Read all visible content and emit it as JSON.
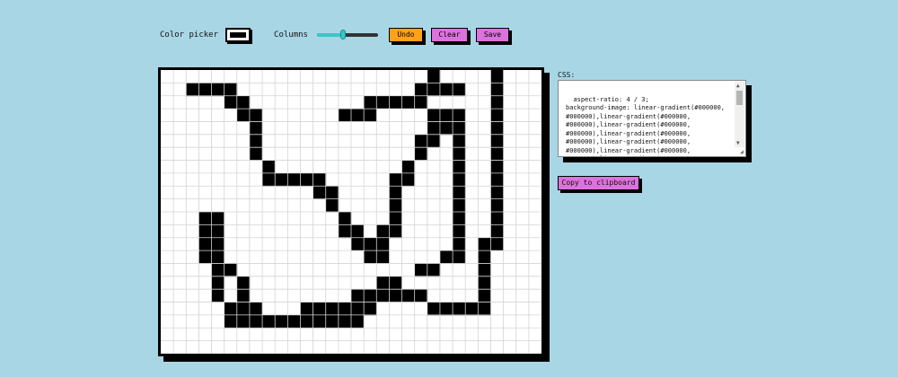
{
  "toolbar": {
    "color_picker_label": "Color picker",
    "color_value": "#000000",
    "columns_label": "Columns",
    "columns_slider_level": 0.42,
    "undo_label": "Undo",
    "clear_label": "Clear",
    "save_label": "Save"
  },
  "colors": {
    "background": "#a9d6e5",
    "undo_button": "#ffa21a",
    "secondary_button": "#dc72dc",
    "slider_accent": "#37c8c8",
    "pixel_fill": "#000000",
    "grid_line": "#d4d4d4"
  },
  "canvas": {
    "columns": 30,
    "rows": 22,
    "filled_cells": [
      [
        21,
        0
      ],
      [
        26,
        0
      ],
      [
        2,
        1
      ],
      [
        3,
        1
      ],
      [
        4,
        1
      ],
      [
        5,
        1
      ],
      [
        20,
        1
      ],
      [
        21,
        1
      ],
      [
        22,
        1
      ],
      [
        23,
        1
      ],
      [
        26,
        1
      ],
      [
        5,
        2
      ],
      [
        6,
        2
      ],
      [
        16,
        2
      ],
      [
        17,
        2
      ],
      [
        18,
        2
      ],
      [
        19,
        2
      ],
      [
        20,
        2
      ],
      [
        26,
        2
      ],
      [
        6,
        3
      ],
      [
        7,
        3
      ],
      [
        14,
        3
      ],
      [
        15,
        3
      ],
      [
        16,
        3
      ],
      [
        21,
        3
      ],
      [
        22,
        3
      ],
      [
        23,
        3
      ],
      [
        26,
        3
      ],
      [
        7,
        4
      ],
      [
        21,
        4
      ],
      [
        22,
        4
      ],
      [
        23,
        4
      ],
      [
        26,
        4
      ],
      [
        7,
        5
      ],
      [
        20,
        5
      ],
      [
        21,
        5
      ],
      [
        23,
        5
      ],
      [
        26,
        5
      ],
      [
        7,
        6
      ],
      [
        20,
        6
      ],
      [
        23,
        6
      ],
      [
        26,
        6
      ],
      [
        8,
        7
      ],
      [
        19,
        7
      ],
      [
        23,
        7
      ],
      [
        26,
        7
      ],
      [
        8,
        8
      ],
      [
        9,
        8
      ],
      [
        10,
        8
      ],
      [
        11,
        8
      ],
      [
        12,
        8
      ],
      [
        18,
        8
      ],
      [
        19,
        8
      ],
      [
        23,
        8
      ],
      [
        26,
        8
      ],
      [
        12,
        9
      ],
      [
        13,
        9
      ],
      [
        18,
        9
      ],
      [
        23,
        9
      ],
      [
        26,
        9
      ],
      [
        13,
        10
      ],
      [
        18,
        10
      ],
      [
        23,
        10
      ],
      [
        26,
        10
      ],
      [
        3,
        11
      ],
      [
        4,
        11
      ],
      [
        14,
        11
      ],
      [
        18,
        11
      ],
      [
        23,
        11
      ],
      [
        26,
        11
      ],
      [
        3,
        12
      ],
      [
        4,
        12
      ],
      [
        14,
        12
      ],
      [
        15,
        12
      ],
      [
        17,
        12
      ],
      [
        18,
        12
      ],
      [
        23,
        12
      ],
      [
        26,
        12
      ],
      [
        3,
        13
      ],
      [
        4,
        13
      ],
      [
        15,
        13
      ],
      [
        16,
        13
      ],
      [
        17,
        13
      ],
      [
        23,
        13
      ],
      [
        25,
        13
      ],
      [
        26,
        13
      ],
      [
        3,
        14
      ],
      [
        4,
        14
      ],
      [
        16,
        14
      ],
      [
        17,
        14
      ],
      [
        22,
        14
      ],
      [
        23,
        14
      ],
      [
        25,
        14
      ],
      [
        4,
        15
      ],
      [
        5,
        15
      ],
      [
        20,
        15
      ],
      [
        21,
        15
      ],
      [
        25,
        15
      ],
      [
        4,
        16
      ],
      [
        6,
        16
      ],
      [
        17,
        16
      ],
      [
        18,
        16
      ],
      [
        25,
        16
      ],
      [
        4,
        17
      ],
      [
        6,
        17
      ],
      [
        15,
        17
      ],
      [
        16,
        17
      ],
      [
        17,
        17
      ],
      [
        18,
        17
      ],
      [
        19,
        17
      ],
      [
        20,
        17
      ],
      [
        25,
        17
      ],
      [
        5,
        18
      ],
      [
        6,
        18
      ],
      [
        7,
        18
      ],
      [
        11,
        18
      ],
      [
        12,
        18
      ],
      [
        13,
        18
      ],
      [
        14,
        18
      ],
      [
        15,
        18
      ],
      [
        16,
        18
      ],
      [
        21,
        18
      ],
      [
        22,
        18
      ],
      [
        23,
        18
      ],
      [
        24,
        18
      ],
      [
        25,
        18
      ],
      [
        5,
        19
      ],
      [
        6,
        19
      ],
      [
        7,
        19
      ],
      [
        8,
        19
      ],
      [
        9,
        19
      ],
      [
        10,
        19
      ],
      [
        11,
        19
      ],
      [
        12,
        19
      ],
      [
        13,
        19
      ],
      [
        14,
        19
      ],
      [
        15,
        19
      ]
    ]
  },
  "css_panel": {
    "label": "CSS:",
    "text": "aspect-ratio: 4 / 3;\nbackground-image: linear-gradient(#000000,\n#000000),linear-gradient(#000000,\n#000000),linear-gradient(#000000,\n#000000),linear-gradient(#000000,\n#000000),linear-gradient(#000000,\n#000000),linear-gradient(#000000,\n#000000),linear-gradient(#000000,\n#000000),linear-gradient(#000000,",
    "copy_label": "Copy to clipboard"
  }
}
